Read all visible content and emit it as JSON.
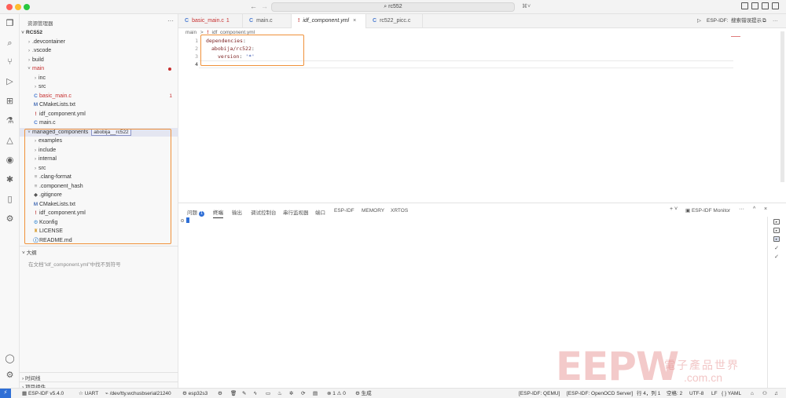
{
  "titlebar": {
    "search": "rc552",
    "back_arrow": "←",
    "forward_arrow": "→",
    "copilot": "⌘˅"
  },
  "activity_bar": {
    "icons": [
      "explorer-icon",
      "search-icon",
      "source-control-icon",
      "run-debug-icon",
      "extensions-icon",
      "testing-icon",
      "platformio-icon",
      "espressif-icon",
      "idf-icon",
      "device-icon",
      "idf-tool-icon",
      "account-icon",
      "gear-icon"
    ]
  },
  "sidebar": {
    "title": "资源管理器",
    "more": "···",
    "project": "RCS52",
    "items": [
      {
        "label": ".devcontainer",
        "type": "folder"
      },
      {
        "label": ".vscode",
        "type": "folder"
      },
      {
        "label": "build",
        "type": "folder"
      },
      {
        "label": "main",
        "type": "folder-open",
        "error": true
      },
      {
        "label": "inc",
        "type": "folder"
      },
      {
        "label": "src",
        "type": "folder"
      },
      {
        "label": "basic_main.c",
        "type": "c",
        "error": true,
        "badge": "1"
      },
      {
        "label": "CMakeLists.txt",
        "type": "m"
      },
      {
        "label": "idf_component.yml",
        "type": "yml"
      },
      {
        "label": "main.c",
        "type": "c"
      },
      {
        "label": "managed_components",
        "type": "folder-open",
        "tag": "abobija__rc522"
      },
      {
        "label": "examples",
        "type": "folder"
      },
      {
        "label": "include",
        "type": "folder"
      },
      {
        "label": "internal",
        "type": "folder"
      },
      {
        "label": "src",
        "type": "folder"
      },
      {
        "label": ".clang-format",
        "type": "eq"
      },
      {
        "label": ".component_hash",
        "type": "eq"
      },
      {
        "label": ".gitignore",
        "type": "git"
      },
      {
        "label": "CMakeLists.txt",
        "type": "m"
      },
      {
        "label": "idf_component.yml",
        "type": "yml"
      },
      {
        "label": "Kconfig",
        "type": "k"
      },
      {
        "label": "LICENSE",
        "type": "lic"
      },
      {
        "label": "README.md",
        "type": "info"
      }
    ],
    "outline_title": "大纲",
    "outline_message": "在文档\"idf_component.yml\"中找不到符号",
    "timeline": "时间线",
    "project_components": "项目组件"
  },
  "tabs": [
    {
      "label": "basic_main.c",
      "suffix": "1",
      "icon": "C",
      "error": true
    },
    {
      "label": "main.c",
      "icon": "C"
    },
    {
      "label": "idf_component.yml",
      "icon": "!",
      "active": true,
      "close": "×"
    },
    {
      "label": "rc522_picc.c",
      "icon": "C"
    }
  ],
  "tab_actions": {
    "run": "▷",
    "esp_idf": "ESP-IDF:",
    "report": "搜索错误提示",
    "split": "⧉",
    "more": "···"
  },
  "breadcrumb": {
    "folder": "main",
    "sep": ">",
    "file_icon": "!",
    "file": "idf_component.yml"
  },
  "editor": {
    "line_numbers": [
      "1",
      "2",
      "3",
      "4"
    ],
    "lines": [
      {
        "key": "dependencies",
        "colon": ":"
      },
      {
        "key": "abobija/rc522",
        "colon": ":"
      },
      {
        "key": "version",
        "colon": ": ",
        "value": "'*'"
      },
      {
        "key": "",
        "colon": ""
      }
    ]
  },
  "panel": {
    "tabs": [
      "问题",
      "终端",
      "输出",
      "调试控制台",
      "串行监视器",
      "端口",
      "ESP-IDF",
      "MEMORY",
      "XRTOS"
    ],
    "problems_badge": "1",
    "right": {
      "add": "+ ˅",
      "terminal_name": "ESP-IDF Monitor",
      "more": "···",
      "chev": "^",
      "close": "×"
    },
    "terminal_list_icons": [
      "▸",
      "▸",
      "▸",
      "✓",
      "✓"
    ]
  },
  "statusbar": {
    "remote": "⚡",
    "esp_idf": "ESP-IDF v5.4.0",
    "uart": "☆ UART",
    "port": "/dev/tty.wchusbserial21240",
    "chip": "esp32s3",
    "problems": "⊗ 1 ⚠ 0",
    "build": "⚙ 生成",
    "qemu": "[ESP-IDF: QEMU]",
    "openocd": "[ESP-IDF: OpenOCD Server]",
    "position": "行 4，列 1",
    "spaces": "空格: 2",
    "encoding": "UTF-8",
    "eol": "LF",
    "language": "{ } YAML"
  },
  "watermark": {
    "brand": "EEPW",
    "cn": "電子產品世界",
    "url": ".com.cn"
  }
}
